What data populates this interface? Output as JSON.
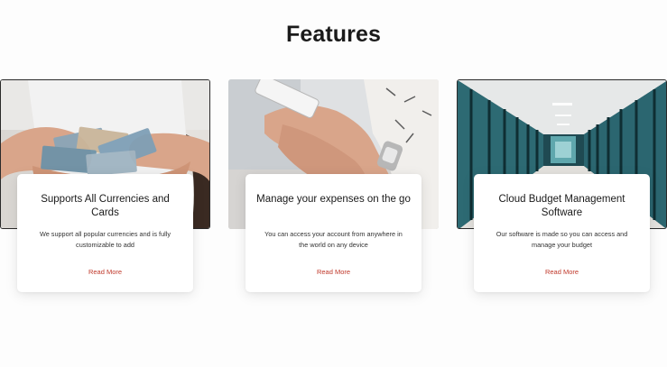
{
  "section": {
    "title": "Features"
  },
  "features": [
    {
      "image": "hands-holding-banknotes-photo",
      "title": "Supports All Currencies and Cards",
      "description": "We support all popular currencies and is fully customizable to add",
      "link": "Read More"
    },
    {
      "image": "hands-using-smartphone-photo",
      "title": "Manage your expenses on the go",
      "description": "You can access your account from anywhere in the world on any device",
      "link": "Read More"
    },
    {
      "image": "server-room-corridor-photo",
      "title": "Cloud Budget Management Software",
      "description": "Our software is made so you can access and manage your budget",
      "link": "Read More"
    }
  ],
  "colors": {
    "background": "#fdfdfd",
    "card": "#ffffff",
    "link": "#c0392b",
    "heading": "#1a1a1a"
  }
}
